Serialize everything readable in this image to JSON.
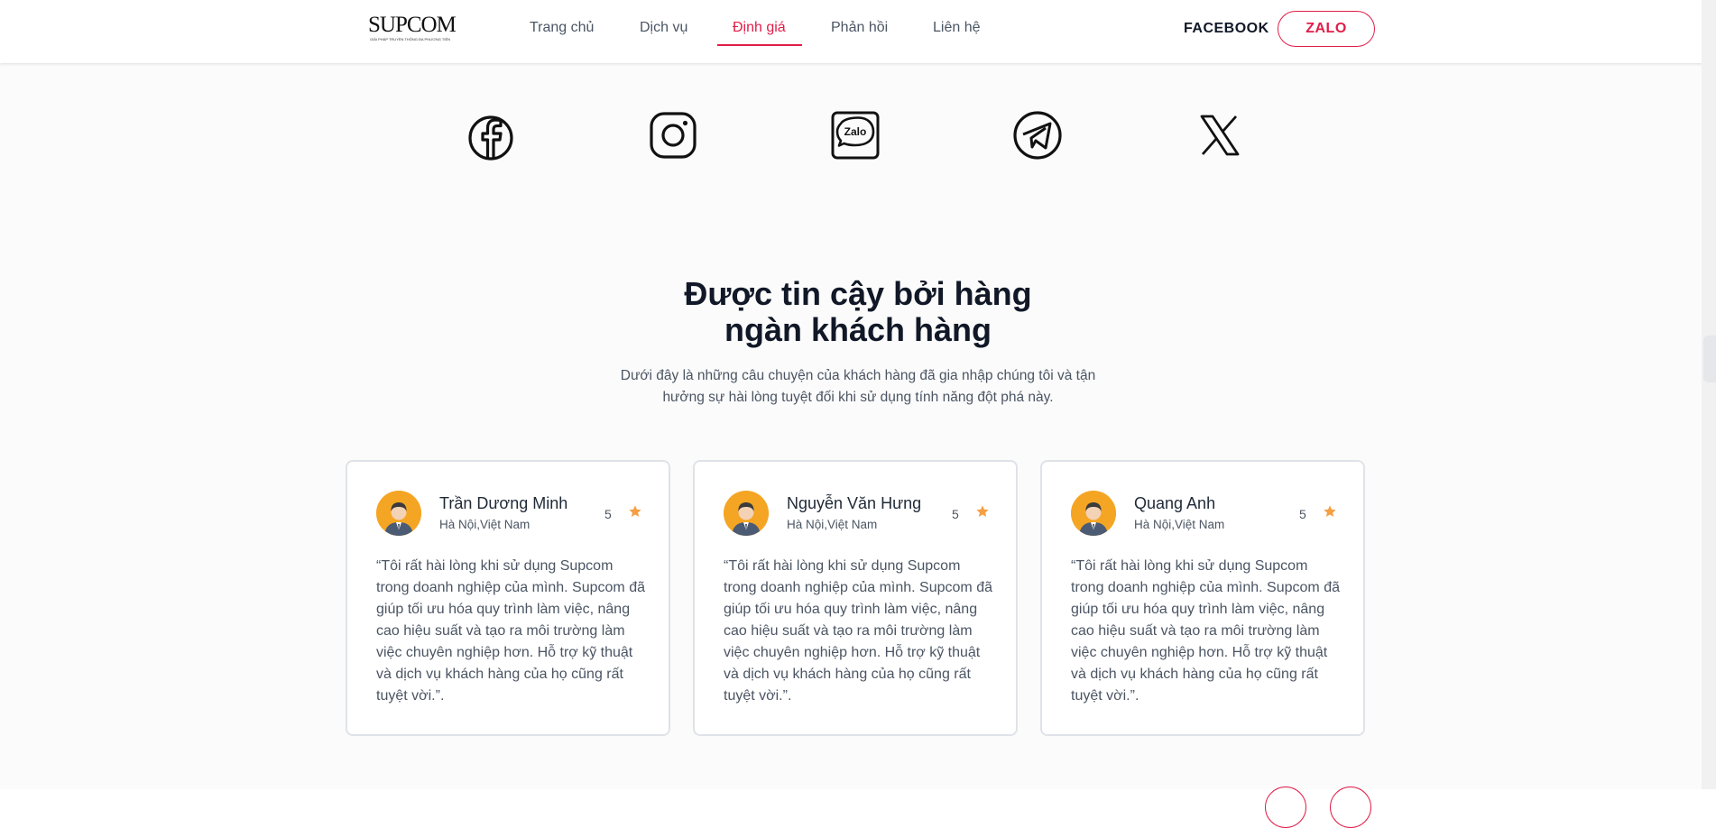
{
  "header": {
    "logo_text": "SUPCOM",
    "logo_tagline": "GIẢI PHÁP TRUYỀN THÔNG ĐA PHƯƠNG TIỆN",
    "nav": [
      {
        "label": "Trang chủ"
      },
      {
        "label": "Dịch vụ"
      },
      {
        "label": "Định giá",
        "active": true
      },
      {
        "label": "Phản hồi"
      },
      {
        "label": "Liên hệ"
      }
    ],
    "facebook_label": "FACEBOOK",
    "zalo_label": "ZALO",
    "accent_color": "#e11d48"
  },
  "social_icons": [
    "facebook-icon",
    "instagram-icon",
    "zalo-icon",
    "telegram-icon",
    "x-icon"
  ],
  "zalo_icon_text": "Zalo",
  "testimonials": {
    "title_line1": "Được tin cậy bởi hàng",
    "title_line2": "ngàn khách hàng",
    "subtitle_line1": "Dưới đây là những câu chuyện của khách hàng đã gia nhập chúng tôi và tận",
    "subtitle_line2": "hưởng sự hài lòng tuyệt đối khi sử dụng tính năng đột phá này.",
    "cards": [
      {
        "name": "Trần Dương Minh",
        "location": "Hà Nội,Việt Nam",
        "rating": "5",
        "quote": "“Tôi rất hài lòng khi sử dụng Supcom trong doanh nghiệp của mình. Supcom đã giúp tối ưu hóa quy trình làm việc, nâng cao hiệu suất và tạo ra môi trường làm việc chuyên nghiệp hơn. Hỗ trợ kỹ thuật và dịch vụ khách hàng của họ cũng rất tuyệt vời.”."
      },
      {
        "name": "Nguyễn Văn Hưng",
        "location": "Hà Nội,Việt Nam",
        "rating": "5",
        "quote": "“Tôi rất hài lòng khi sử dụng Supcom trong doanh nghiệp của mình. Supcom đã giúp tối ưu hóa quy trình làm việc, nâng cao hiệu suất và tạo ra môi trường làm việc chuyên nghiệp hơn. Hỗ trợ kỹ thuật và dịch vụ khách hàng của họ cũng rất tuyệt vời.”."
      },
      {
        "name": "Quang Anh",
        "location": "Hà Nội,Việt Nam",
        "rating": "5",
        "quote": "“Tôi rất hài lòng khi sử dụng Supcom trong doanh nghiệp của mình. Supcom đã giúp tối ưu hóa quy trình làm việc, nâng cao hiệu suất và tạo ra môi trường làm việc chuyên nghiệp hơn. Hỗ trợ kỹ thuật và dịch vụ khách hàng của họ cũng rất tuyệt vời.”."
      }
    ],
    "star_color": "#f59e42",
    "avatar_color": "#f5a524"
  }
}
